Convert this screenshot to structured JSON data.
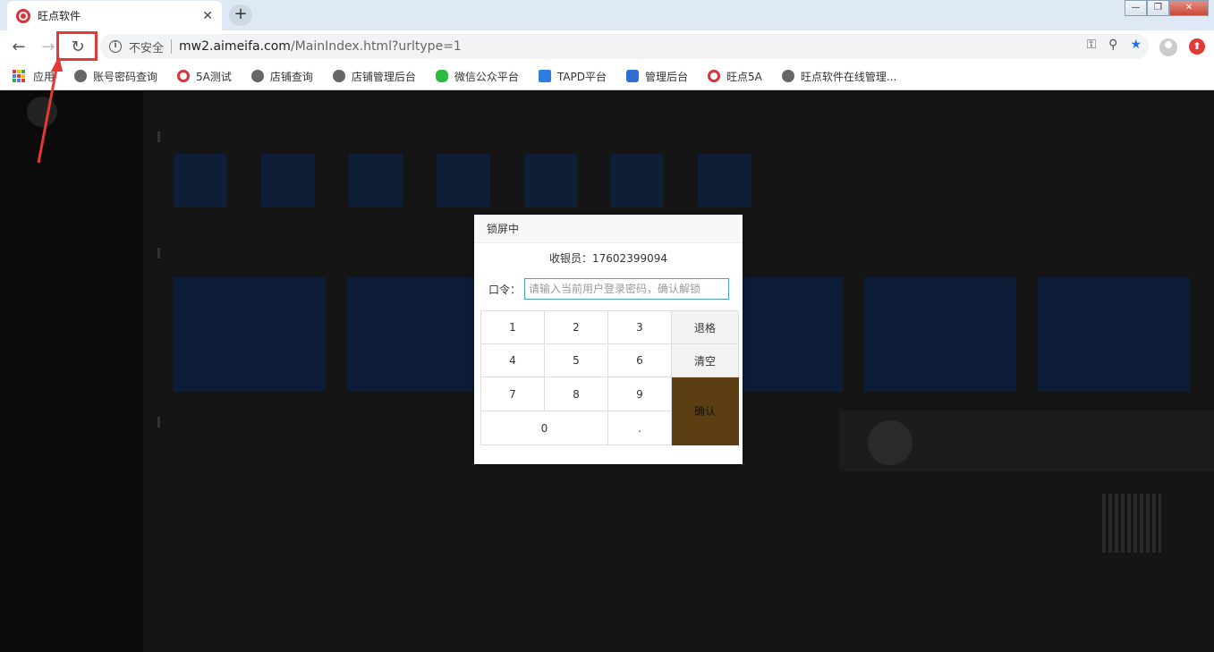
{
  "browser": {
    "tab_title": "旺点软件",
    "tab_close": "✕",
    "new_tab": "+",
    "window_controls": {
      "minimize": "—",
      "restore": "❐",
      "close": "✕"
    },
    "nav": {
      "back": "←",
      "forward": "→",
      "reload": "↻"
    },
    "omnibox": {
      "security_label": "不安全",
      "url_host": "mw2.aimeifa.com",
      "url_path": "/MainIndex.html?urltype=1",
      "icons": [
        "key-icon",
        "zoom-icon",
        "star-icon"
      ]
    }
  },
  "bookmarks": [
    {
      "label": "应用",
      "icon": "apps-icon"
    },
    {
      "label": "账号密码查询",
      "icon": "globe-icon"
    },
    {
      "label": "5A测试",
      "icon": "wangdian-icon"
    },
    {
      "label": "店铺查询",
      "icon": "globe-icon"
    },
    {
      "label": "店铺管理后台",
      "icon": "globe-icon"
    },
    {
      "label": "微信公众平台",
      "icon": "wechat-icon"
    },
    {
      "label": "TAPD平台",
      "icon": "tapd-icon"
    },
    {
      "label": "管理后台",
      "icon": "admin-icon"
    },
    {
      "label": "旺点5A",
      "icon": "wangdian-icon"
    },
    {
      "label": "旺点软件在线管理...",
      "icon": "globe-icon"
    }
  ],
  "lock_dialog": {
    "title": "锁屏中",
    "cashier_label": "收银员：",
    "cashier_value": "17602399094",
    "password_label": "口令：",
    "password_placeholder": "请输入当前用户登录密码，确认解锁",
    "keys": {
      "k1": "1",
      "k2": "2",
      "k3": "3",
      "k4": "4",
      "k5": "5",
      "k6": "6",
      "k7": "7",
      "k8": "8",
      "k9": "9",
      "k0": "0",
      "dot": ".",
      "backspace": "退格",
      "clear": "清空",
      "confirm": "确认"
    }
  },
  "colors": {
    "accent_red": "#e53935",
    "confirm_button": "#5b3f12",
    "input_border": "#4aa0c8",
    "overlay": "#151515"
  }
}
